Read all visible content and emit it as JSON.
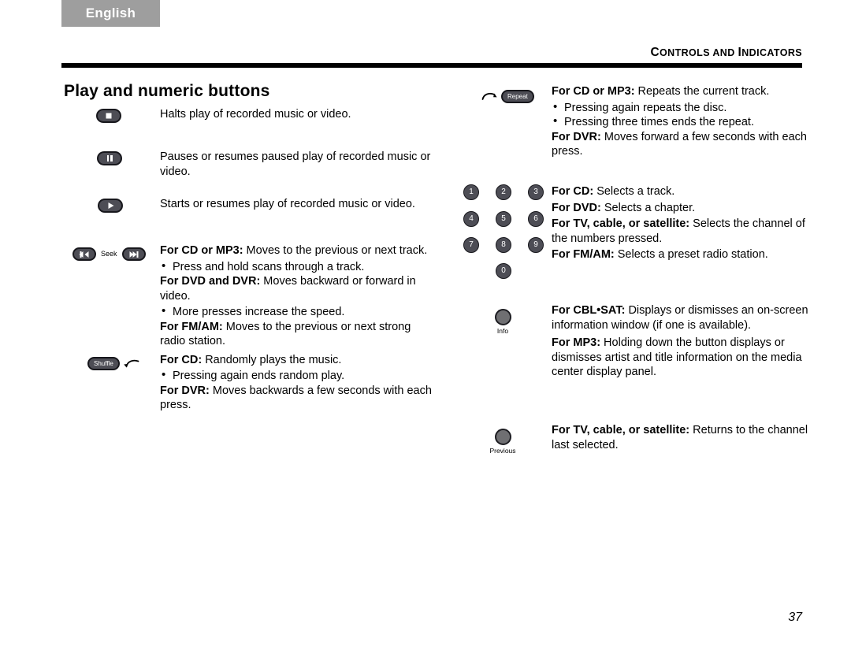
{
  "header": {
    "language_tab": "English",
    "section_title_first": "C",
    "section_title_rest": "ONTROLS AND ",
    "section_title_i": "I",
    "section_title_tail": "NDICATORS",
    "section_title_full": "CONTROLS AND INDICATORS"
  },
  "page": {
    "title": "Play and numeric buttons",
    "number": "37"
  },
  "left_column": {
    "entries": [
      {
        "icon": "stop-button",
        "lines": [
          {
            "kind": "para",
            "text": "Halts play of recorded music or video."
          }
        ]
      },
      {
        "icon": "pause-button",
        "lines": [
          {
            "kind": "para",
            "text": "Pauses or resumes paused play of recorded music or video."
          }
        ]
      },
      {
        "icon": "play-button",
        "lines": [
          {
            "kind": "para",
            "text": "Starts or resumes play of recorded music or video."
          }
        ]
      },
      {
        "icon": "seek-buttons",
        "seek_label": "Seek",
        "lines": [
          {
            "kind": "para",
            "bold": "For CD or MP3:",
            "text": " Moves to the previous or next track."
          },
          {
            "kind": "bullet",
            "text": "Press and hold scans through a track."
          },
          {
            "kind": "para",
            "bold": "For DVD and DVR:",
            "text": " Moves backward or forward in video."
          },
          {
            "kind": "bullet",
            "text": "More presses increase the speed."
          },
          {
            "kind": "para",
            "bold": "For FM/AM:",
            "text": " Moves to the previous or next strong radio station."
          }
        ]
      },
      {
        "icon": "shuffle-button",
        "button_label": "Shuffle",
        "lines": [
          {
            "kind": "para",
            "bold": "For CD:",
            "text": " Randomly plays the music."
          },
          {
            "kind": "bullet",
            "text": "Pressing again ends random play."
          },
          {
            "kind": "para",
            "bold": "For DVR:",
            "text": " Moves backwards a few seconds with each press."
          }
        ]
      }
    ]
  },
  "right_column": {
    "entries": [
      {
        "icon": "repeat-button",
        "button_label": "Repeat",
        "lines": [
          {
            "kind": "para",
            "bold": "For CD or MP3:",
            "text": " Repeats the current track."
          },
          {
            "kind": "bullet",
            "text": "Pressing again repeats the disc."
          },
          {
            "kind": "bullet",
            "text": "Pressing three times ends the repeat."
          },
          {
            "kind": "para",
            "bold": "For DVR:",
            "text": " Moves forward a few seconds with each press."
          }
        ]
      },
      {
        "icon": "numeric-keypad",
        "keys": [
          "1",
          "2",
          "3",
          "4",
          "5",
          "6",
          "7",
          "8",
          "9",
          "0"
        ],
        "lines": [
          {
            "kind": "para",
            "bold": "For CD:",
            "text": " Selects a track."
          },
          {
            "kind": "para",
            "bold": "For DVD:",
            "text": " Selects a chapter."
          },
          {
            "kind": "para",
            "bold": "For TV, cable, or satellite:",
            "text": " Selects the channel of the numbers pressed."
          },
          {
            "kind": "para",
            "bold": "For FM/AM:",
            "text": " Selects a preset radio station."
          }
        ]
      },
      {
        "icon": "info-button",
        "button_caption": "Info",
        "lines": [
          {
            "kind": "para",
            "bold": "For CBL•SAT:",
            "text": " Displays or dismisses an on-screen information window (if one is available)."
          },
          {
            "kind": "para",
            "bold": "For MP3:",
            "text": " Holding down the button displays or dismisses artist and title information on the media center display panel."
          }
        ]
      },
      {
        "icon": "previous-button",
        "button_caption": "Previous",
        "lines": [
          {
            "kind": "para",
            "bold": "For TV, cable, or satellite:",
            "text": " Returns to the channel last selected."
          }
        ]
      }
    ]
  },
  "colors": {
    "tab_background": "#9e9e9e",
    "button_fill": "#4d4d55",
    "button_stroke": "#17171c",
    "round_button_fill": "#6f6f72",
    "rule": "#000000"
  }
}
